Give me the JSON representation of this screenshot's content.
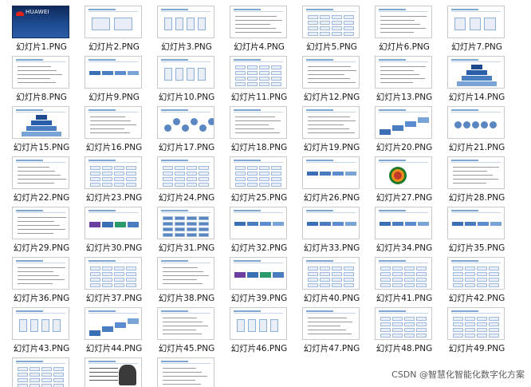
{
  "folder": {
    "files": [
      {
        "label": "幻灯片1.PNG",
        "brand": "HUAWEI"
      },
      {
        "label": "幻灯片2.PNG"
      },
      {
        "label": "幻灯片3.PNG"
      },
      {
        "label": "幻灯片4.PNG"
      },
      {
        "label": "幻灯片5.PNG"
      },
      {
        "label": "幻灯片6.PNG"
      },
      {
        "label": "幻灯片7.PNG"
      },
      {
        "label": "幻灯片8.PNG"
      },
      {
        "label": "幻灯片9.PNG"
      },
      {
        "label": "幻灯片10.PNG"
      },
      {
        "label": "幻灯片11.PNG"
      },
      {
        "label": "幻灯片12.PNG"
      },
      {
        "label": "幻灯片13.PNG"
      },
      {
        "label": "幻灯片14.PNG"
      },
      {
        "label": "幻灯片15.PNG"
      },
      {
        "label": "幻灯片16.PNG"
      },
      {
        "label": "幻灯片17.PNG"
      },
      {
        "label": "幻灯片18.PNG"
      },
      {
        "label": "幻灯片19.PNG"
      },
      {
        "label": "幻灯片20.PNG"
      },
      {
        "label": "幻灯片21.PNG"
      },
      {
        "label": "幻灯片22.PNG"
      },
      {
        "label": "幻灯片23.PNG"
      },
      {
        "label": "幻灯片24.PNG"
      },
      {
        "label": "幻灯片25.PNG"
      },
      {
        "label": "幻灯片26.PNG"
      },
      {
        "label": "幻灯片27.PNG"
      },
      {
        "label": "幻灯片28.PNG"
      },
      {
        "label": "幻灯片29.PNG"
      },
      {
        "label": "幻灯片30.PNG"
      },
      {
        "label": "幻灯片31.PNG"
      },
      {
        "label": "幻灯片32.PNG"
      },
      {
        "label": "幻灯片33.PNG"
      },
      {
        "label": "幻灯片34.PNG"
      },
      {
        "label": "幻灯片35.PNG"
      },
      {
        "label": "幻灯片36.PNG"
      },
      {
        "label": "幻灯片37.PNG"
      },
      {
        "label": "幻灯片38.PNG"
      },
      {
        "label": "幻灯片39.PNG"
      },
      {
        "label": "幻灯片40.PNG"
      },
      {
        "label": "幻灯片41.PNG"
      },
      {
        "label": "幻灯片42.PNG"
      },
      {
        "label": "幻灯片43.PNG"
      },
      {
        "label": "幻灯片44.PNG"
      },
      {
        "label": "幻灯片45.PNG"
      },
      {
        "label": "幻灯片46.PNG"
      },
      {
        "label": "幻灯片47.PNG"
      },
      {
        "label": "幻灯片48.PNG"
      },
      {
        "label": "幻灯片49.PNG"
      },
      {
        "label": ""
      },
      {
        "label": ""
      },
      {
        "label": ""
      }
    ]
  },
  "watermark": "CSDN @智慧化智能化数字化方案",
  "colors": {
    "accent": "#2b5ea8",
    "thumb_border": "#c8c8c8",
    "title_slide_bg": "#1d4a8f",
    "huawei_red": "#e2231a"
  }
}
